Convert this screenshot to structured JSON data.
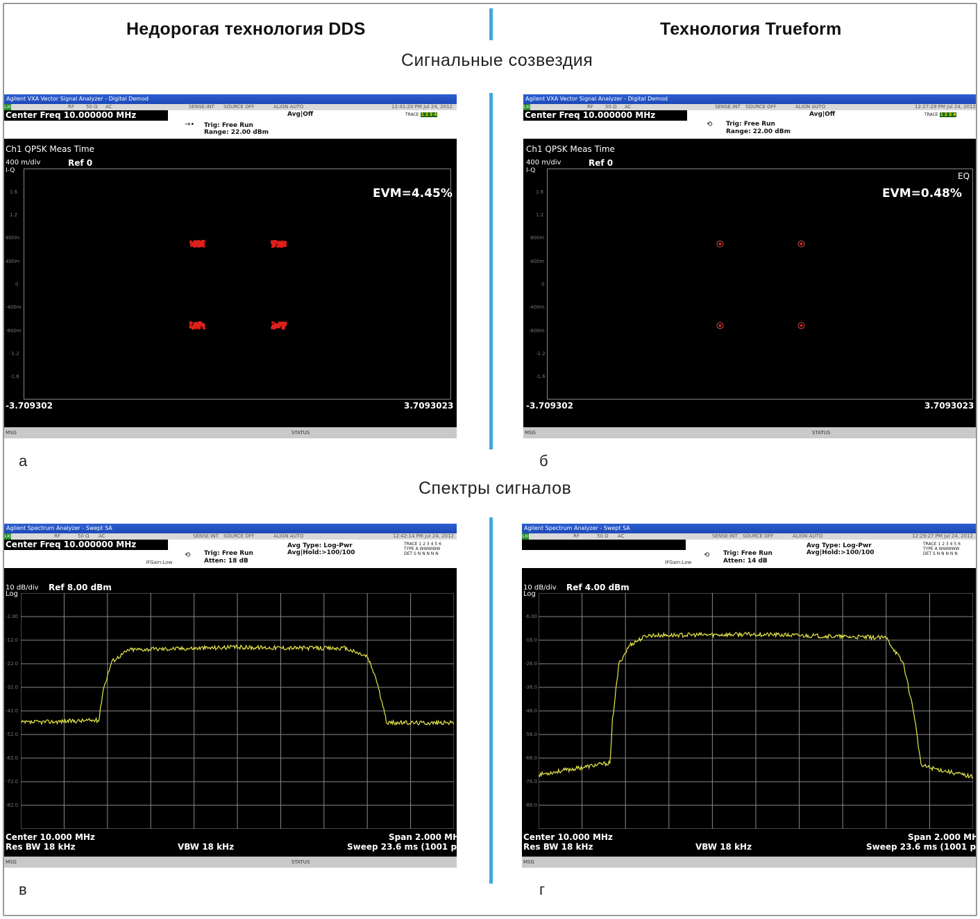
{
  "columns": {
    "left_title": "Недорогая технология DDS",
    "right_title": "Технология Trueform"
  },
  "sections": {
    "constellations": "Сигнальные созвездия",
    "spectra": "Спектры сигналов"
  },
  "panels": {
    "a": {
      "letter": "а",
      "window_title": "Agilent VXA Vector Signal Analyzer - Digital Demod",
      "center_freq": "Center Freq 10.000000 MHz",
      "status_bits": [
        "RF",
        "50 Ω",
        "AC",
        "SENSE:INT",
        "SOURCE OFF",
        "ALIGN AUTO"
      ],
      "timestamp": "12:41:20 PM Jul 24, 2012",
      "avg": "Avg|Off",
      "trace_label": "TRACE",
      "trace_values": "1 2 3 4",
      "trig": "Trig: Free Run",
      "range": "Range: 22.00 dBm",
      "meas_title": "Ch1 QPSK Meas Time",
      "scale": "400 m/div",
      "ref": "Ref 0",
      "axis_name": "I-Q",
      "evm": "EVM=4.45%",
      "x_min": "-3.709302",
      "x_max": "3.7093023",
      "msg": "MSG",
      "status": "STATUS",
      "y_ticks": [
        "1.6",
        "1.2",
        "800m",
        "400m",
        "0",
        "-400m",
        "-800m",
        "-1.2",
        "-1.6"
      ]
    },
    "b": {
      "letter": "б",
      "window_title": "Agilent VXA Vector Signal Analyzer - Digital Demod",
      "center_freq": "Center Freq 10.000000 MHz",
      "status_bits": [
        "RF",
        "50 Ω",
        "AC",
        "SENSE:INT",
        "SOURCE OFF",
        "ALIGN AUTO"
      ],
      "timestamp": "12:27:29 PM Jul 24, 2012",
      "avg": "Avg|Off",
      "trace_label": "TRACE",
      "trace_values": "1 2 3 4",
      "trig": "Trig: Free Run",
      "range": "Range: 22.00 dBm",
      "meas_title": "Ch1 QPSK Meas Time",
      "scale": "400 m/div",
      "ref": "Ref 0",
      "axis_name": "I-Q",
      "eq": "EQ",
      "evm": "EVM=0.48%",
      "x_min": "-3.709302",
      "x_max": "3.7093023",
      "msg": "MSG",
      "status": "STATUS",
      "y_ticks": [
        "1.6",
        "1.2",
        "800m",
        "400m",
        "0",
        "-400m",
        "-800m",
        "-1.2",
        "-1.6"
      ]
    },
    "c": {
      "letter": "в",
      "window_title": "Agilent Spectrum Analyzer - Swept SA",
      "center_freq": "Center Freq 10.000000 MHz",
      "status_bits": [
        "RF",
        "50 Ω",
        "AC",
        "SENSE:INT",
        "SOURCE OFF",
        "ALIGN AUTO"
      ],
      "timestamp": "12:42:14 PM Jul 24, 2012",
      "avg_type": "Avg Type: Log-Pwr",
      "avg_hold": "Avg|Hold:>100/100",
      "trace_rows": [
        "TRACE 1 2 3 4 5 6",
        "TYPE A WWWWW",
        "DET S N N N N N"
      ],
      "trig": "Trig: Free Run",
      "atten": "Atten: 18 dB",
      "ifgain": "IFGain:Low",
      "scale": "10 dB/div",
      "ref": "Ref 8.00 dBm",
      "scale_type": "Log",
      "y_ticks": [
        "-2.00",
        "-12.0",
        "-22.0",
        "-32.0",
        "-42.0",
        "-52.0",
        "-62.0",
        "-72.0",
        "-82.0"
      ],
      "center": "Center 10.000 MHz",
      "res_bw": "Res BW 18 kHz",
      "vbw": "VBW 18 kHz",
      "span": "Span 2.000 MHz",
      "sweep": "Sweep  23.6 ms (1001 pts)",
      "msg": "MSG",
      "status": "STATUS"
    },
    "d": {
      "letter": "г",
      "window_title": "Agilent Spectrum Analyzer - Swept SA",
      "status_bits": [
        "RF",
        "50 Ω",
        "AC",
        "SENSE:INT",
        "SOURCE OFF",
        "ALIGN AUTO"
      ],
      "timestamp": "12:29:27 PM Jul 24, 2012",
      "avg_type": "Avg Type: Log-Pwr",
      "avg_hold": "Avg|Hold:>100/100",
      "trace_rows": [
        "TRACE 1 2 3 4 5 6",
        "TYPE A WWWWW",
        "DET S N N N N N"
      ],
      "trig": "Trig: Free Run",
      "atten": "Atten: 14 dB",
      "ifgain": "IFGain:Low",
      "scale": "10 dB/div",
      "ref": "Ref 4.00 dBm",
      "scale_type": "Log",
      "y_ticks": [
        "-6.00",
        "-16.0",
        "-26.0",
        "-36.0",
        "-46.0",
        "-56.0",
        "-66.0",
        "-76.0",
        "-86.0"
      ],
      "center": "Center 10.000 MHz",
      "res_bw": "Res BW 18 kHz",
      "vbw": "VBW 18 kHz",
      "span": "Span 2.000 MHz",
      "sweep": "Sweep  23.6 ms (1001 pts)",
      "msg": "MSG"
    }
  },
  "chart_data": [
    {
      "type": "scatter",
      "panel": "a",
      "xlabel": "",
      "ylabel": "I-Q",
      "x_range": [
        -3.709302,
        3.7093023
      ],
      "ylim": [
        -2.0,
        2.0
      ],
      "series": [
        {
          "color": "#e0201c",
          "points": [
            [
              -0.707,
              0.707
            ],
            [
              0.707,
              0.707
            ],
            [
              -0.707,
              -0.707
            ],
            [
              0.707,
              -0.707
            ]
          ],
          "spread": 0.05
        }
      ]
    },
    {
      "type": "scatter",
      "panel": "b",
      "xlabel": "",
      "ylabel": "I-Q",
      "x_range": [
        -3.709302,
        3.7093023
      ],
      "ylim": [
        -2.0,
        2.0
      ],
      "series": [
        {
          "color": "#e0201c",
          "points": [
            [
              -0.707,
              0.707
            ],
            [
              0.707,
              0.707
            ],
            [
              -0.707,
              -0.707
            ],
            [
              0.707,
              -0.707
            ]
          ],
          "spread": 0.005
        }
      ]
    },
    {
      "type": "line",
      "panel": "c",
      "x_range_mhz": [
        9.0,
        11.0
      ],
      "ylim": [
        -92.0,
        8.0
      ],
      "color": "#e8e84a",
      "x": [
        9.0,
        9.33,
        9.36,
        9.38,
        9.42,
        9.5,
        10.0,
        10.5,
        10.6,
        10.64,
        10.69,
        10.72,
        11.0
      ],
      "y": [
        -47,
        -46,
        -46,
        -33,
        -21,
        -16,
        -15,
        -15.5,
        -19,
        -28,
        -47,
        -47,
        -47
      ]
    },
    {
      "type": "line",
      "panel": "d",
      "x_range_mhz": [
        9.0,
        11.0
      ],
      "ylim": [
        -96.0,
        4.0
      ],
      "color": "#e8e84a",
      "x": [
        9.0,
        9.33,
        9.34,
        9.37,
        9.42,
        9.5,
        10.0,
        10.6,
        10.68,
        10.73,
        10.76,
        10.8,
        11.0
      ],
      "y": [
        -73,
        -68,
        -50,
        -26,
        -18,
        -14,
        -13.5,
        -15,
        -26,
        -48,
        -69,
        -70,
        -74
      ]
    }
  ]
}
